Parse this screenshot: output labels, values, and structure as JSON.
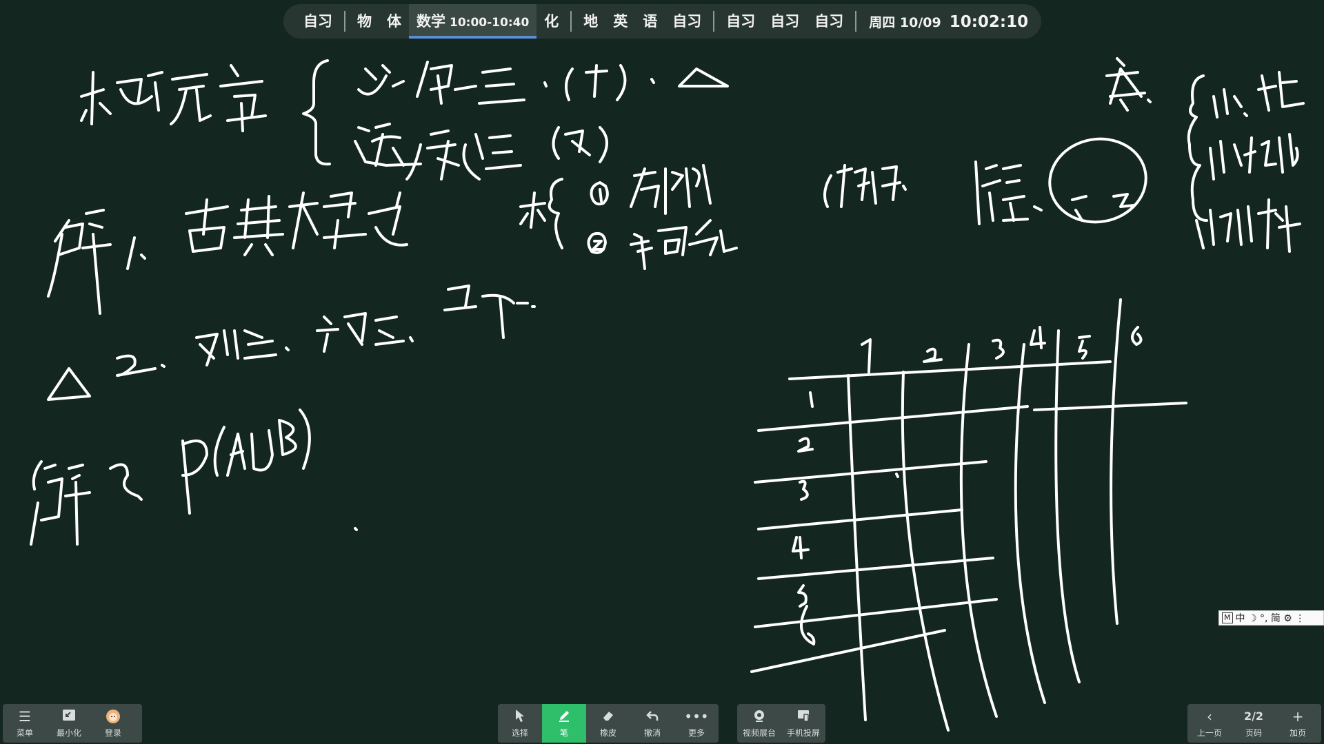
{
  "schedule": {
    "items": [
      {
        "label": "自习"
      },
      {
        "label": "物"
      },
      {
        "label": "体"
      },
      {
        "label": "数学",
        "time": "10:00-10:40",
        "active": true
      },
      {
        "label": "化"
      },
      {
        "label": "地"
      },
      {
        "label": "英"
      },
      {
        "label": "语"
      },
      {
        "label": "自习"
      },
      {
        "label": "自习"
      },
      {
        "label": "自习"
      },
      {
        "label": "自习"
      }
    ],
    "date": "周四 10/09",
    "time": "10:02:10"
  },
  "toolbar_left": {
    "menu": "菜单",
    "minimize": "最小化",
    "login": "登录"
  },
  "toolbar_center": {
    "select": "选择",
    "pen": "笔",
    "eraser": "橡皮",
    "undo": "撤消",
    "more": "更多"
  },
  "toolbar_media": {
    "visualizer": "视频展台",
    "phone_cast": "手机投屏"
  },
  "toolbar_page": {
    "prev": "上一页",
    "page_value": "2/2",
    "page_label": "页码",
    "add": "加页"
  },
  "ime": {
    "text": "中 ☽ °, 简 ⚙ ⋮"
  },
  "board": {
    "grid_row_labels": [
      "1",
      "2",
      "3",
      "4",
      "5",
      "6"
    ],
    "grid_col_labels": [
      "1",
      "2",
      "3",
      "4",
      "5",
      "6"
    ]
  }
}
